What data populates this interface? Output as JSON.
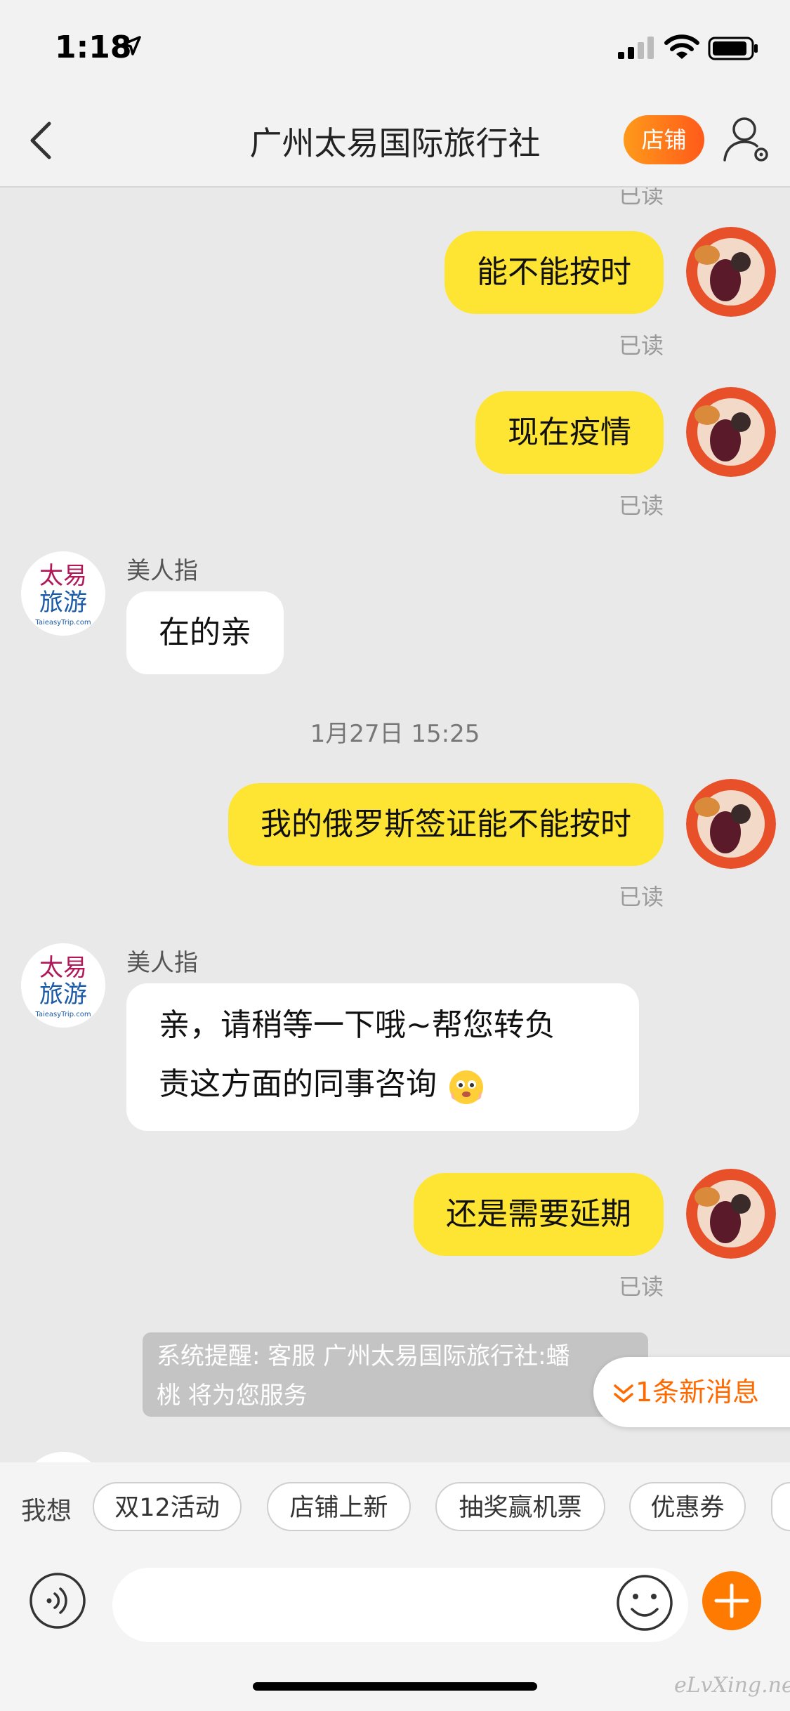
{
  "status_bar": {
    "time": "1:18"
  },
  "nav": {
    "title": "广州太易国际旅行社",
    "shop_label": "店铺"
  },
  "chat": {
    "partial_top_read": "已读",
    "messages": [
      {
        "text": "能不能按时",
        "read": "已读"
      },
      {
        "text": "现在疫情",
        "read": "已读"
      },
      {
        "sender": "美人指",
        "text": "在的亲"
      },
      {
        "timestamp": "1月27日 15:25"
      },
      {
        "text": "我的俄罗斯签证能不能按时",
        "read": "已读"
      },
      {
        "sender": "美人指",
        "line1": "亲，请稍等一下哦~帮您转负",
        "line2": "责这方面的同事咨询"
      },
      {
        "text": "还是需要延期",
        "read": "已读"
      }
    ],
    "system_line1": "系统提醒: 客服 广州太易国际旅行社:蟠",
    "system_line2": "桃 将为您服务",
    "new_message": "1条新消息",
    "avatar_text_1": "太易",
    "avatar_text_2": "旅游",
    "avatar_text_3": "TaieasyTrip.com"
  },
  "quick_bar": {
    "label": "我想",
    "chips": [
      "双12活动",
      "店铺上新",
      "抽奖赢机票",
      "优惠券"
    ]
  },
  "watermark": "eLvXing.net",
  "colors": {
    "accent": "#ff6a00",
    "my_bubble": "#ffe533"
  }
}
